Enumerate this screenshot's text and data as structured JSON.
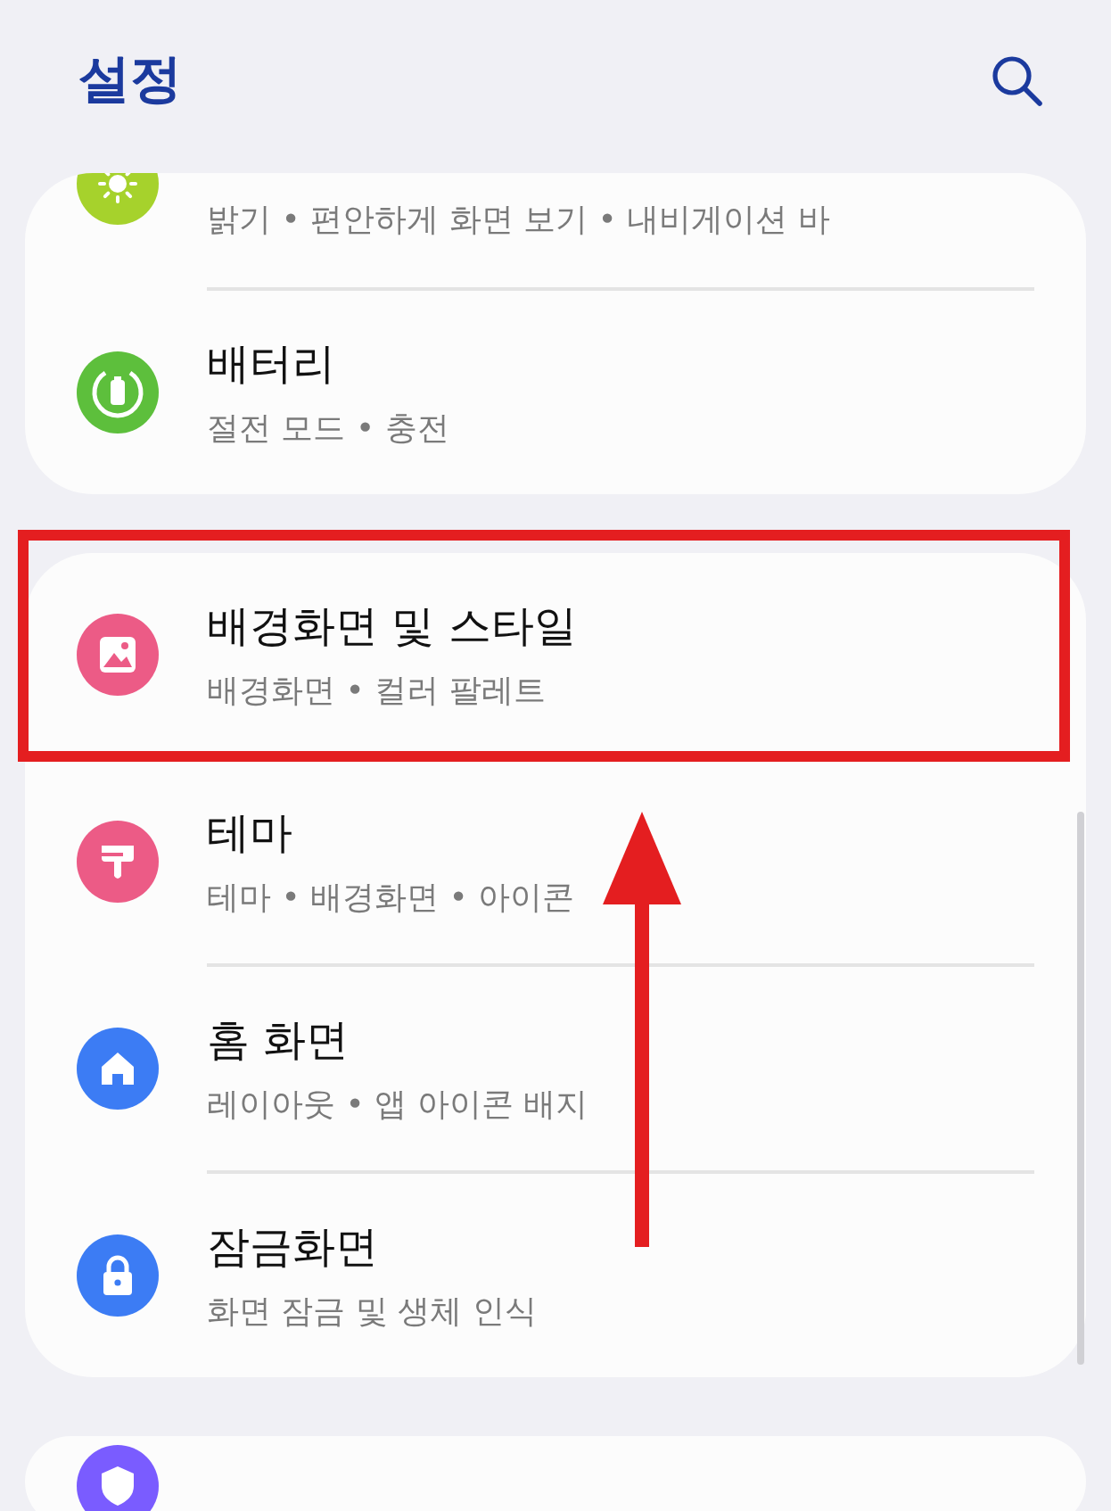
{
  "header": {
    "title": "설정"
  },
  "cards": [
    {
      "items": [
        {
          "kind": "partial",
          "color": "#a6d22c",
          "subtitle": "밝기 • 편안하게 화면 보기 • 내비게이션 바"
        },
        {
          "kind": "full",
          "color": "#5dbf3c",
          "title": "배터리",
          "subtitle": "절전 모드 • 충전"
        }
      ]
    },
    {
      "items": [
        {
          "kind": "full",
          "color": "#ec5b86",
          "title": "배경화면 및 스타일",
          "subtitle": "배경화면 • 컬러 팔레트"
        },
        {
          "kind": "full",
          "color": "#ec5b86",
          "title": "테마",
          "subtitle": "테마 • 배경화면 • 아이콘"
        },
        {
          "kind": "full",
          "color": "#3c7cf4",
          "title": "홈 화면",
          "subtitle": "레이아웃 • 앱 아이콘 배지"
        },
        {
          "kind": "full",
          "color": "#3c7cf4",
          "title": "잠금화면",
          "subtitle": "화면 잠금 및 생체 인식"
        }
      ]
    },
    {
      "items": [
        {
          "kind": "cut",
          "color": "#7a5cff"
        }
      ]
    }
  ]
}
